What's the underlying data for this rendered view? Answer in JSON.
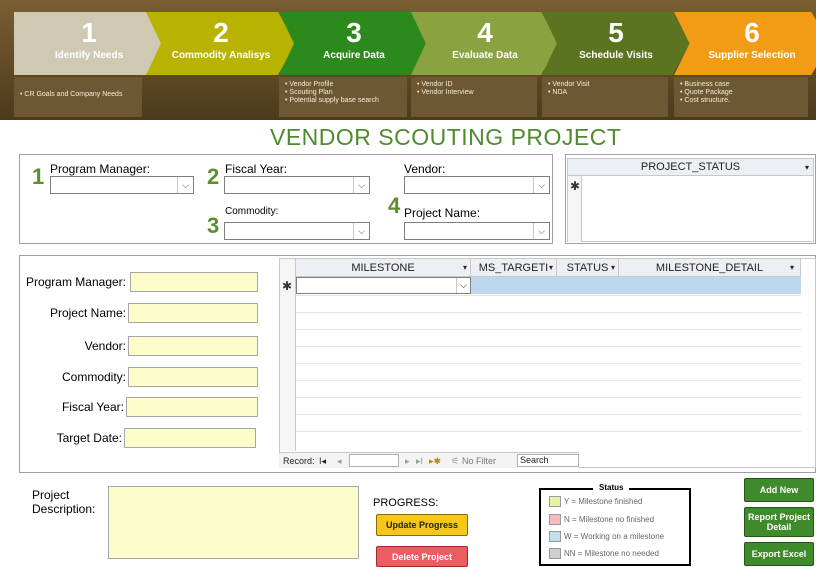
{
  "steps": [
    {
      "num": "1",
      "label": "Identify Needs",
      "color": "#cfc9b3"
    },
    {
      "num": "2",
      "label": "Commodity Analisys",
      "color": "#b8b300"
    },
    {
      "num": "3",
      "label": "Acquire Data",
      "color": "#2b8a1b"
    },
    {
      "num": "4",
      "label": "Evaluate Data",
      "color": "#8ba240"
    },
    {
      "num": "5",
      "label": "Schedule Visits",
      "color": "#5c7420"
    },
    {
      "num": "6",
      "label": "Supplier Selection",
      "color": "#f29c16"
    }
  ],
  "subs": [
    [
      "• CR Goals and Company Needs"
    ],
    [],
    [
      "• Vendor Profile",
      "• Scouting Plan",
      "• Potential supply base search"
    ],
    [
      "• Vendor ID",
      "• Vendor Interview"
    ],
    [
      "• Vendor Visit",
      "• NDA"
    ],
    [
      "• Business case",
      "• Quote Package",
      "• Cost structure."
    ]
  ],
  "title": "VENDOR SCOUTING PROJECT",
  "filters": {
    "num1": "1",
    "program_manager": "Program Manager:",
    "num2": "2",
    "fiscal_year": "Fiscal Year:",
    "vendor": "Vendor:",
    "num3": "3",
    "commodity": "Commodity:",
    "num4": "4",
    "project_name": "Project Name:"
  },
  "status_grid": {
    "header": "PROJECT_STATUS",
    "new_row": "✱"
  },
  "form": {
    "program_manager": "Program Manager:",
    "project_name": "Project Name:",
    "vendor": "Vendor:",
    "commodity": "Commodity:",
    "fiscal_year": "Fiscal Year:",
    "target_date": "Target Date:"
  },
  "milestones": {
    "columns": [
      "MILESTONE",
      "MS_TARGETI",
      "STATUS",
      "MILESTONE_DETAIL"
    ],
    "new_row": "✱"
  },
  "nav": {
    "record": "Record:",
    "first": "I◂",
    "prev": "◂",
    "next": "▸",
    "last": "▸I",
    "new": "▸✱",
    "filter": "No Filter",
    "search": "Search"
  },
  "project_description": "Project Description:",
  "progress": "PROGRESS:",
  "buttons": {
    "update": "Update Progress",
    "delete": "Delete Project",
    "add_new": "Add New",
    "report": "Report Project Detail",
    "export": "Export Excel"
  },
  "legend": {
    "title": "Status",
    "items": [
      {
        "text": "Y = Milestone finished",
        "color": "#e6f2a8"
      },
      {
        "text": "N = Milestone no finished",
        "color": "#f4bcc1"
      },
      {
        "text": "W = Working on a milestone",
        "color": "#bfe2ea"
      },
      {
        "text": "NN = Milestone no needed",
        "color": "#cfcfcf"
      }
    ]
  }
}
